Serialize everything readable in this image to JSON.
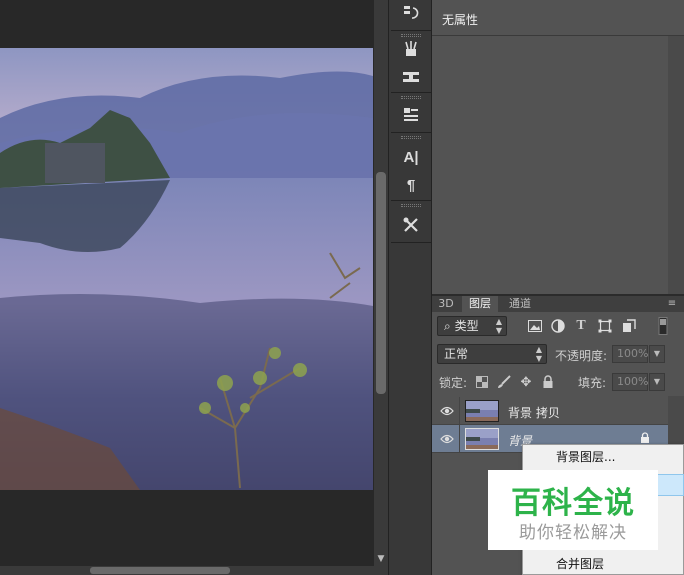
{
  "properties": {
    "title": "无属性"
  },
  "layers_panel": {
    "tabs": [
      {
        "label": "3D",
        "active": false
      },
      {
        "label": "图层",
        "active": true
      },
      {
        "label": "通道",
        "active": false
      }
    ],
    "filter_kind": "类型",
    "blend_mode": "正常",
    "opacity_label": "不透明度:",
    "opacity_value": "100%",
    "lock_label": "锁定:",
    "fill_label": "填充:",
    "fill_value": "100%",
    "layers": [
      {
        "name": "背景 拷贝",
        "selected": false,
        "locked": false
      },
      {
        "name": "背景",
        "selected": true,
        "locked": true
      }
    ]
  },
  "context_menu": {
    "items": [
      {
        "label": "背景图层...",
        "highlighted": false
      },
      {
        "label": "",
        "highlighted": true
      },
      {
        "label": "合并图层",
        "highlighted": false
      }
    ]
  },
  "watermark": {
    "title": "百科全说",
    "subtitle": "助你轻松解决"
  },
  "tools": [
    "history-icon",
    "brush-presets-icon",
    "clone-source-icon",
    "paragraph-styles-icon",
    "character-icon",
    "paragraph-icon",
    "tool-presets-icon"
  ],
  "colors": {
    "panel_bg": "#535353",
    "selected_layer": "#6e7d93",
    "watermark_green": "#2db34a"
  }
}
